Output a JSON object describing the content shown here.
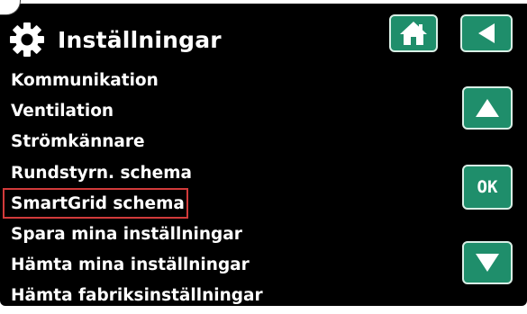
{
  "header": {
    "title": "Inställningar",
    "icon": "gear-icon"
  },
  "nav": {
    "home_icon": "home-icon",
    "back_icon": "back-arrow-icon",
    "up_icon": "up-arrow-icon",
    "ok_label": "OK",
    "down_icon": "down-arrow-icon"
  },
  "menu": {
    "selected_index": 4,
    "items": [
      {
        "label": "Kommunikation"
      },
      {
        "label": "Ventilation"
      },
      {
        "label": "Strömkännare"
      },
      {
        "label": "Rundstyrn. schema"
      },
      {
        "label": "SmartGrid schema"
      },
      {
        "label": "Spara mina inställningar"
      },
      {
        "label": "Hämta mina inställningar"
      },
      {
        "label": "Hämta fabriksinställningar"
      }
    ]
  },
  "colors": {
    "background": "#000000",
    "button": "#1f8e6b",
    "selection": "#d23a3a",
    "text": "#ffffff"
  }
}
